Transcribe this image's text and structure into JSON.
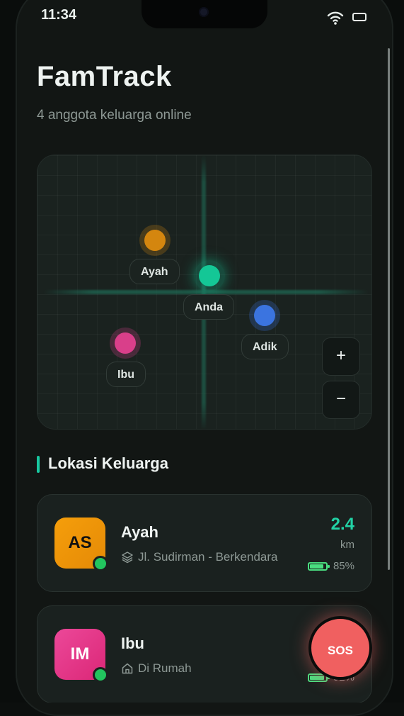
{
  "status": {
    "time": "11:34"
  },
  "header": {
    "title": "FamTrack",
    "subtitle": "4 anggota keluarga online"
  },
  "map": {
    "pins": [
      {
        "label": "Ayah",
        "color": "#d4860f"
      },
      {
        "label": "Anda",
        "color": "#14c796"
      },
      {
        "label": "Adik",
        "color": "#3b74e0"
      },
      {
        "label": "Ibu",
        "color": "#d93f8a"
      }
    ],
    "zoom_in_label": "+",
    "zoom_out_label": "−"
  },
  "section": {
    "title": "Lokasi Keluarga"
  },
  "members": [
    {
      "initials": "AS",
      "name": "Ayah",
      "location": "Jl. Sudirman - Berkendara",
      "location_icon": "layers-icon",
      "distance": "2.4",
      "distance_unit": "km",
      "battery": "85%",
      "battery_level": 0.85,
      "avatar_color": "#f59e0b"
    },
    {
      "initials": "IM",
      "name": "Ibu",
      "location": "Di Rumah",
      "location_icon": "home-icon",
      "battery": "92%",
      "battery_level": 0.92,
      "avatar_color": "#ec4899"
    }
  ],
  "sos": {
    "label": "SOS"
  },
  "colors": {
    "accent": "#18c8a0",
    "online": "#22c55e",
    "sos": "#f06060"
  }
}
